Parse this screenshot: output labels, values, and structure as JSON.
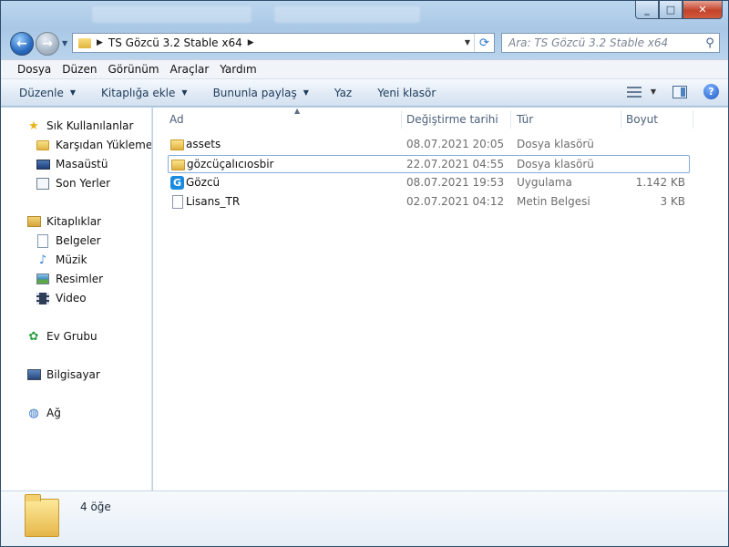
{
  "window": {
    "controls": {
      "minimize": "_",
      "maximize": "□",
      "close": "✕"
    }
  },
  "address": {
    "path": "TS Gözcü 3.2 Stable x64",
    "search_placeholder": "Ara: TS Gözcü 3.2 Stable x64"
  },
  "menu": [
    "Dosya",
    "Düzen",
    "Görünüm",
    "Araçlar",
    "Yardım"
  ],
  "toolbar": {
    "organize": "Düzenle",
    "add_to_library": "Kitaplığa ekle",
    "share_with": "Bununla paylaş",
    "burn": "Yaz",
    "new_folder": "Yeni klasör",
    "help": "?"
  },
  "nav": {
    "favorites": "Sık Kullanılanlar",
    "downloads": "Karşıdan Yüklemeler",
    "desktop": "Masaüstü",
    "recent": "Son Yerler",
    "libraries": "Kitaplıklar",
    "documents": "Belgeler",
    "music": "Müzik",
    "pictures": "Resimler",
    "videos": "Video",
    "homegroup": "Ev Grubu",
    "computer": "Bilgisayar",
    "network": "Ağ"
  },
  "columns": {
    "name": "Ad",
    "date": "Değiştirme tarihi",
    "type": "Tür",
    "size": "Boyut"
  },
  "files": [
    {
      "name": "assets",
      "date": "08.07.2021 20:05",
      "type": "Dosya klasörü",
      "size": "",
      "icon": "folder-icon"
    },
    {
      "name": "gözcüçalıcıosbir",
      "date": "22.07.2021 04:55",
      "type": "Dosya klasörü",
      "size": "",
      "icon": "folder-icon"
    },
    {
      "name": "Gözcü",
      "date": "08.07.2021 19:53",
      "type": "Uygulama",
      "size": "1.142 KB",
      "icon": "app-icon"
    },
    {
      "name": "Lisans_TR",
      "date": "02.07.2021 04:12",
      "type": "Metin Belgesi",
      "size": "3 KB",
      "icon": "text-file-icon"
    }
  ],
  "app_icon_letter": "G",
  "status": {
    "count": "4 öğe"
  }
}
